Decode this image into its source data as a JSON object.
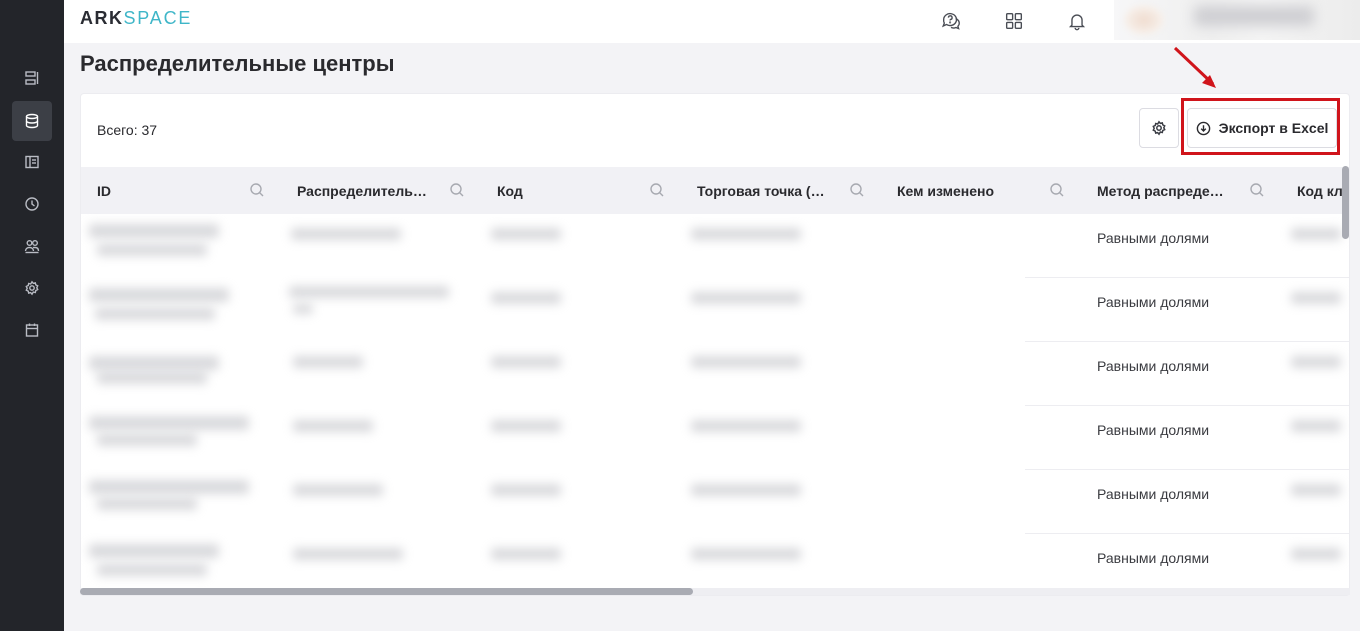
{
  "app": {
    "logo_part1": "ARK",
    "logo_part2": "SPACE",
    "brand_color": "#3fb6c8"
  },
  "sidebar": {
    "items": [
      {
        "icon": "list-icon",
        "active": false
      },
      {
        "icon": "database-icon",
        "active": true
      },
      {
        "icon": "layout-icon",
        "active": false
      },
      {
        "icon": "clock-icon",
        "active": false
      },
      {
        "icon": "users-icon",
        "active": false
      },
      {
        "icon": "gear-icon",
        "active": false
      },
      {
        "icon": "calendar-icon",
        "active": false
      }
    ]
  },
  "header": {
    "icons": [
      "help-chat-icon",
      "apps-grid-icon",
      "bell-icon"
    ]
  },
  "page": {
    "title": "Распределительные центры",
    "total_label": "Всего: 37",
    "export_label": "Экспорт в Excel",
    "highlight_color": "#d0141b"
  },
  "table": {
    "columns": [
      "ID",
      "Распределительн...",
      "Код",
      "Торговая точка (о...",
      "Кем изменено",
      "Метод распредел...",
      "Код кл"
    ],
    "rows": [
      {
        "method": "Равными долями"
      },
      {
        "method": "Равными долями"
      },
      {
        "method": "Равными долями"
      },
      {
        "method": "Равными долями"
      },
      {
        "method": "Равными долями"
      },
      {
        "method": "Равными долями"
      }
    ]
  }
}
